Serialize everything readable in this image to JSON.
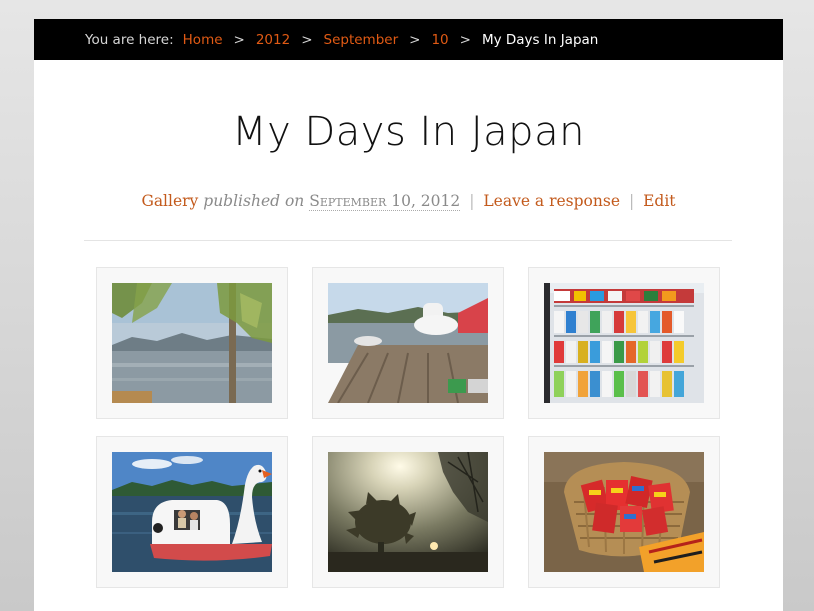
{
  "breadcrumb": {
    "prefix": "You are here:",
    "links": [
      "Home",
      "2012",
      "September",
      "10"
    ],
    "separator": ">",
    "current": "My Days In Japan"
  },
  "post": {
    "title": "My Days In Japan",
    "category": "Gallery",
    "published_label": "published on",
    "date": "September 10, 2012",
    "meta_separator": "|",
    "comment_link": "Leave a response",
    "edit_link": "Edit"
  },
  "gallery": {
    "items": [
      {
        "subject": "lake-willow-tree-photo"
      },
      {
        "subject": "wooden-pier-boats-photo"
      },
      {
        "subject": "vending-drinks-cooler-photo"
      },
      {
        "subject": "swan-paddle-boat-photo"
      },
      {
        "subject": "sunflower-sunset-photo"
      },
      {
        "subject": "snack-basket-photo"
      }
    ]
  },
  "colors": {
    "accent": "#e05a14",
    "meta_link": "#c35a1c",
    "breadcrumb_bg": "#000000"
  }
}
